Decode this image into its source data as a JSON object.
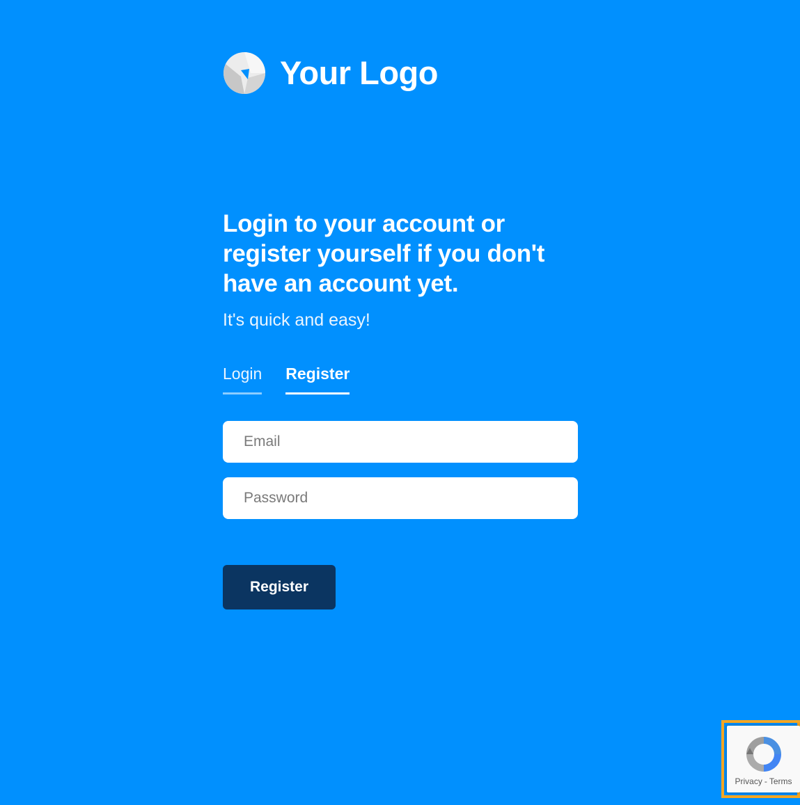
{
  "brand": {
    "logo_icon": "logo-icon",
    "logo_text": "Your Logo"
  },
  "hero": {
    "headline": "Login to your account or register yourself if you don't have an account yet.",
    "subline": "It's quick and easy!"
  },
  "tabs": [
    {
      "label": "Login",
      "active": false
    },
    {
      "label": "Register",
      "active": true
    }
  ],
  "form": {
    "email": {
      "placeholder": "Email",
      "value": ""
    },
    "password": {
      "placeholder": "Password",
      "value": ""
    },
    "submit_label": "Register"
  },
  "recaptcha": {
    "icon": "recaptcha-icon",
    "privacy_label": "Privacy",
    "separator": "-",
    "terms_label": "Terms"
  },
  "colors": {
    "background": "#0190fe",
    "button": "#0b3561",
    "highlight": "#f5a623"
  }
}
